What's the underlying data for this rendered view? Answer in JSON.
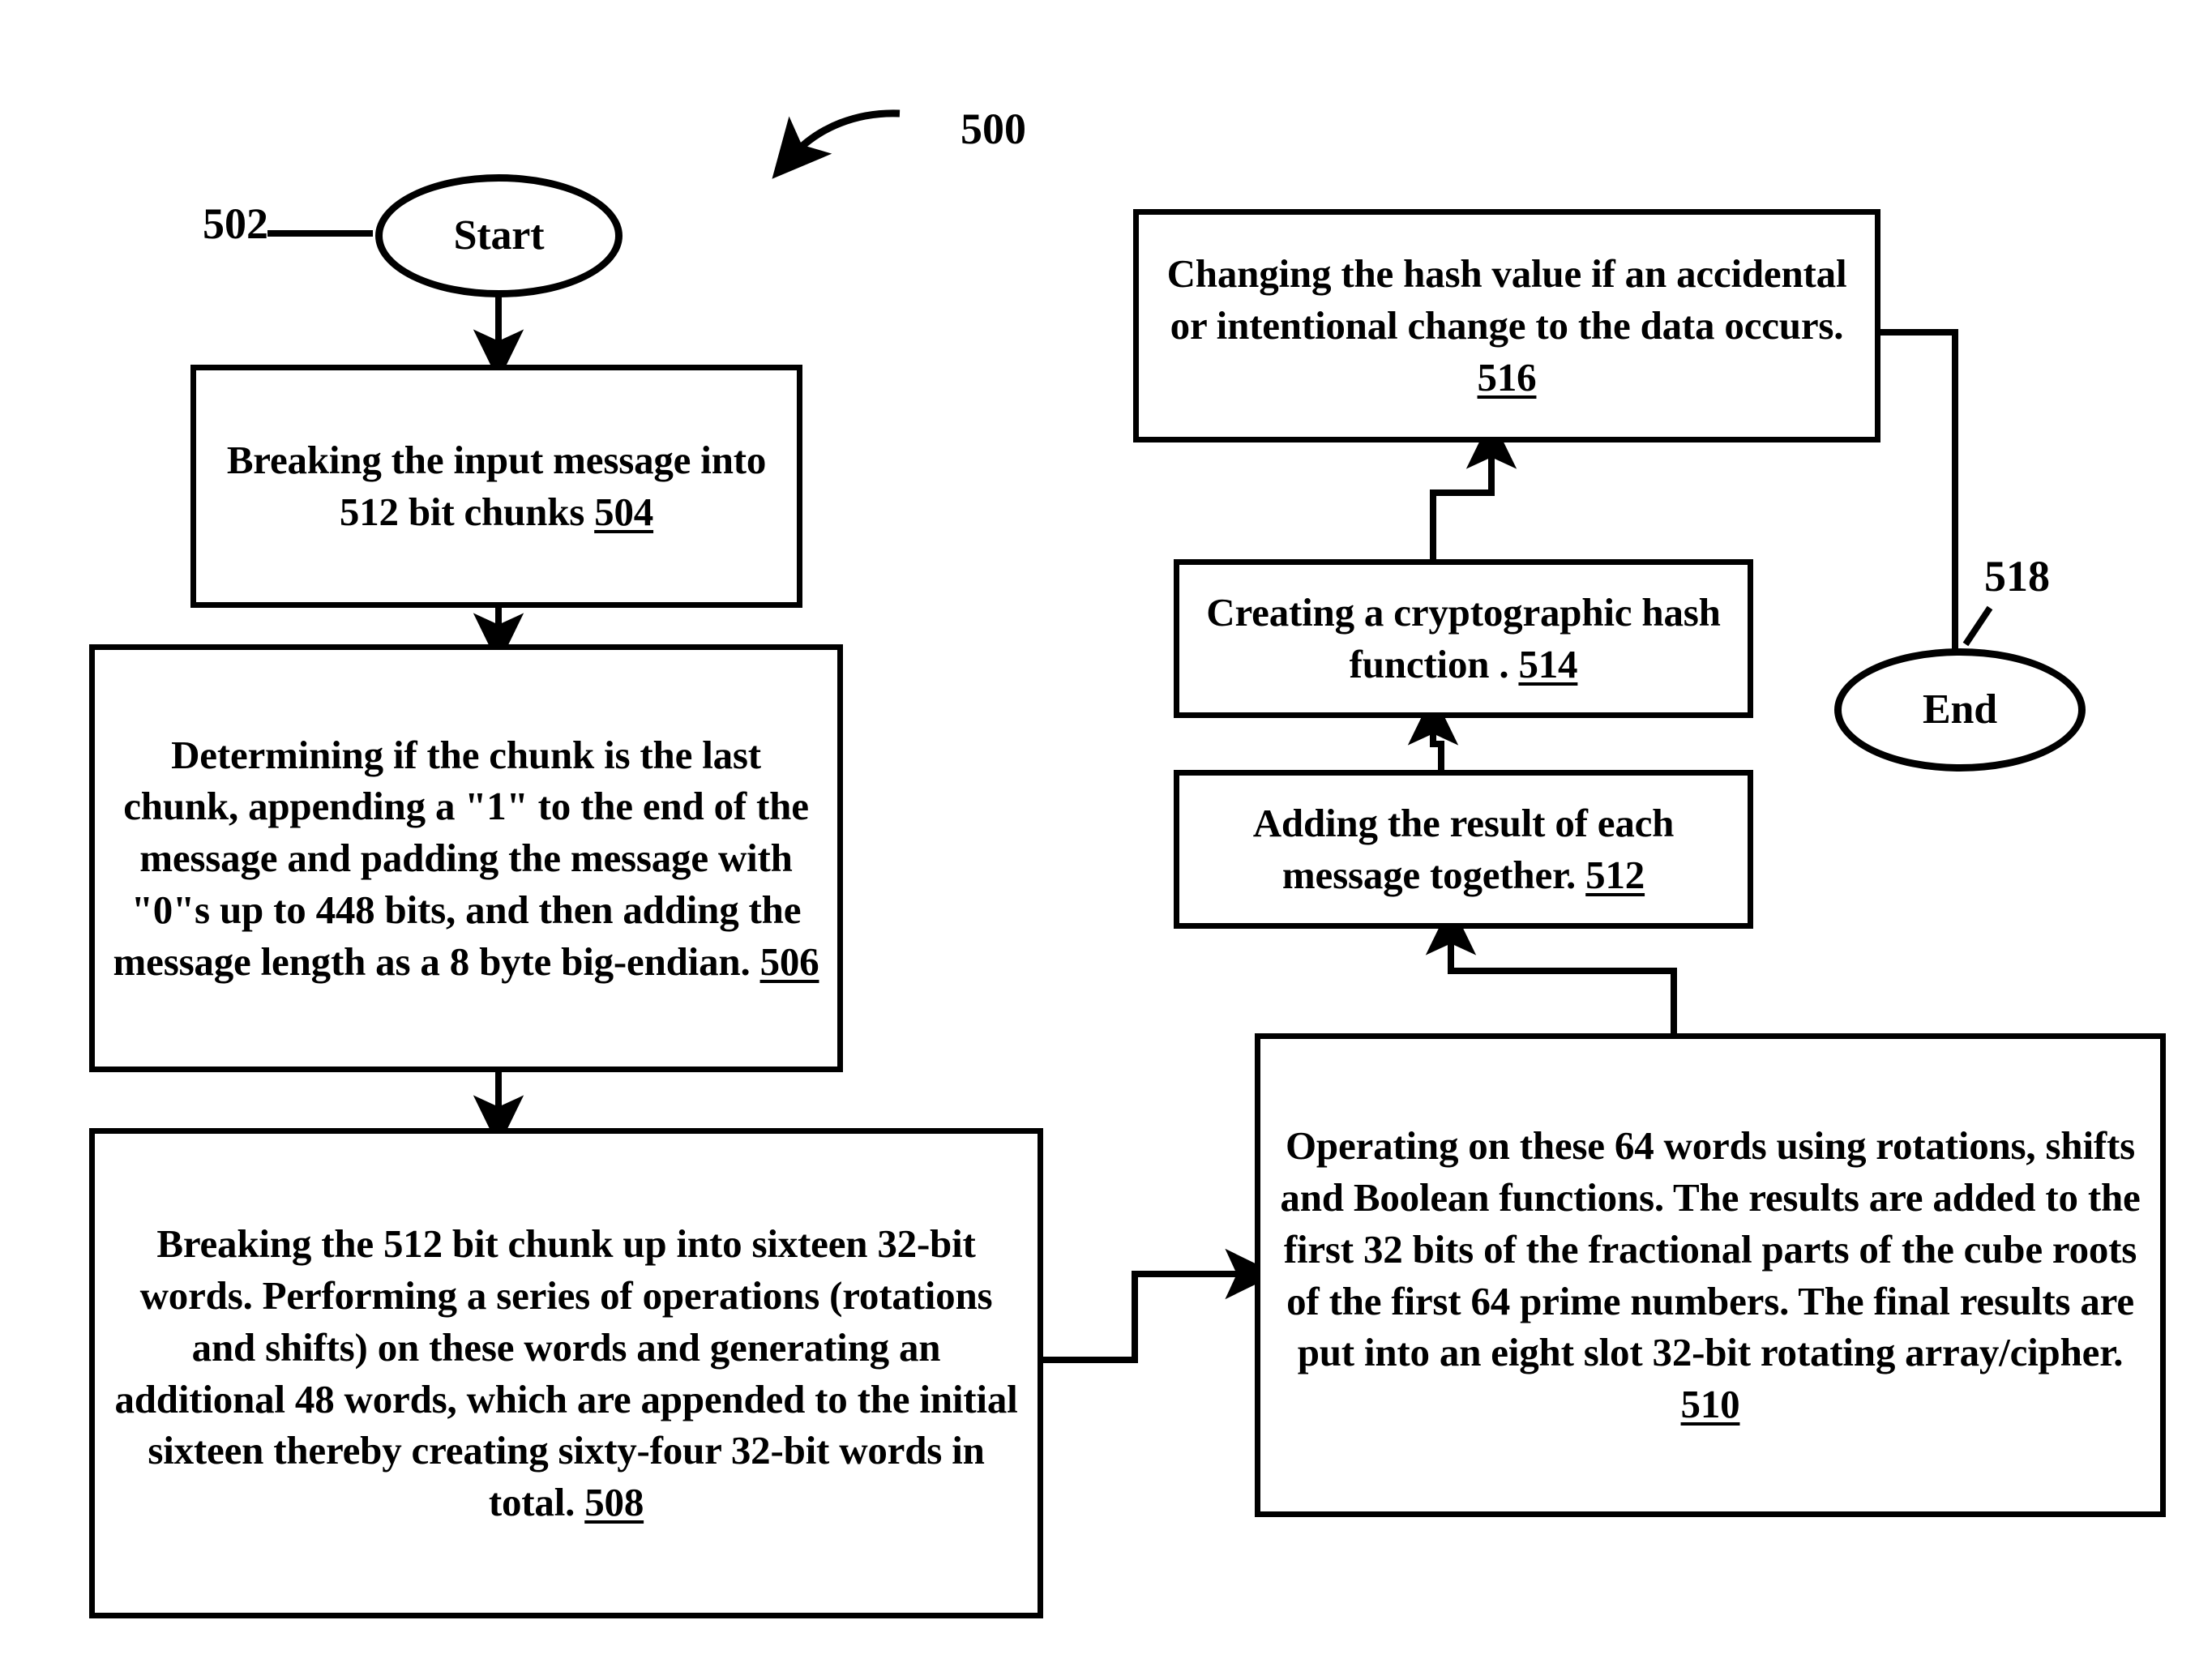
{
  "figure": {
    "number": "500",
    "title_label": "500"
  },
  "reference_labels": {
    "figure": "500",
    "start_ref": "502",
    "end_ref": "518"
  },
  "nodes": {
    "start": {
      "shape": "ellipse",
      "label": "Start",
      "ref": "502"
    },
    "step504": {
      "shape": "process",
      "text": "Breaking the input message into 512 bit chunks ",
      "ref": "504"
    },
    "step506": {
      "shape": "process",
      "text": "Determining if the chunk is the last chunk, appending a \"1\" to the end of the message and padding the message with \"0\"s up to 448 bits, and then adding the message length as a 8 byte big-endian.  ",
      "ref": "506"
    },
    "step508": {
      "shape": "process",
      "text": "Breaking the 512 bit chunk up into sixteen 32-bit words.  Performing a series of operations (rotations and shifts) on these words and generating an additional 48 words, which are appended to the initial sixteen thereby creating sixty-four 32-bit words in total.  ",
      "ref": "508"
    },
    "step510": {
      "shape": "process",
      "text": "Operating on these 64 words using rotations, shifts and Boolean functions.  The results are added to the first 32 bits of the fractional parts of the cube roots of the first 64 prime numbers.  The final results are put into an eight slot 32-bit rotating array/cipher.  ",
      "ref": "510"
    },
    "step512": {
      "shape": "process",
      "text": "Adding the result of each message together.  ",
      "ref": "512"
    },
    "step514": {
      "shape": "process",
      "text": "Creating a cryptographic hash function . ",
      "ref": "514"
    },
    "step516": {
      "shape": "process",
      "text": "Changing the hash value if an accidental or intentional change to the data occurs.  ",
      "ref": "516"
    },
    "end": {
      "shape": "ellipse",
      "label": "End",
      "ref": "518"
    }
  },
  "flow_sequence": [
    "start",
    "step504",
    "step506",
    "step508",
    "step510",
    "step512",
    "step514",
    "step516",
    "end"
  ],
  "colors": {
    "stroke": "#000000",
    "fill": "#ffffff",
    "text": "#000000"
  }
}
